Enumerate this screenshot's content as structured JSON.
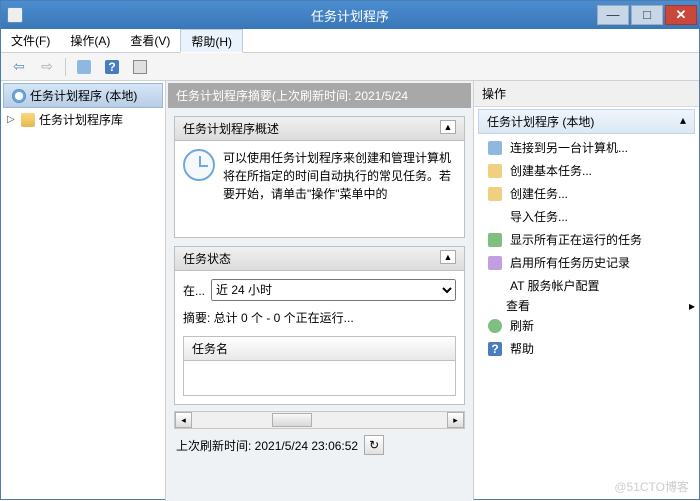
{
  "window": {
    "title": "任务计划程序"
  },
  "menus": {
    "file": "文件(F)",
    "action": "操作(A)",
    "view": "查看(V)",
    "help": "帮助(H)"
  },
  "tree": {
    "root": "任务计划程序 (本地)",
    "library": "任务计划程序库"
  },
  "middle": {
    "header": "任务计划程序摘要(上次刷新时间: 2021/5/24",
    "overview_title": "任务计划程序概述",
    "overview_text": "可以使用任务计划程序来创建和管理计算机将在所指定的时间自动执行的常见任务。若要开始，请单击\"操作\"菜单中的",
    "status_title": "任务状态",
    "status_label": "在...",
    "status_select": "近 24 小时",
    "summary": "摘要: 总计 0 个 - 0 个正在运行...",
    "task_name_header": "任务名",
    "last_refresh": "上次刷新时间: 2021/5/24 23:06:52"
  },
  "actions": {
    "header": "操作",
    "section": "任务计划程序 (本地)",
    "items": {
      "connect": "连接到另一台计算机...",
      "create_basic": "创建基本任务...",
      "create_task": "创建任务...",
      "import": "导入任务...",
      "show_running": "显示所有正在运行的任务",
      "enable_history": "启用所有任务历史记录",
      "at_service": "AT 服务帐户配置",
      "view": "查看",
      "refresh": "刷新",
      "help": "帮助"
    }
  },
  "watermark": "@51CTO博客"
}
